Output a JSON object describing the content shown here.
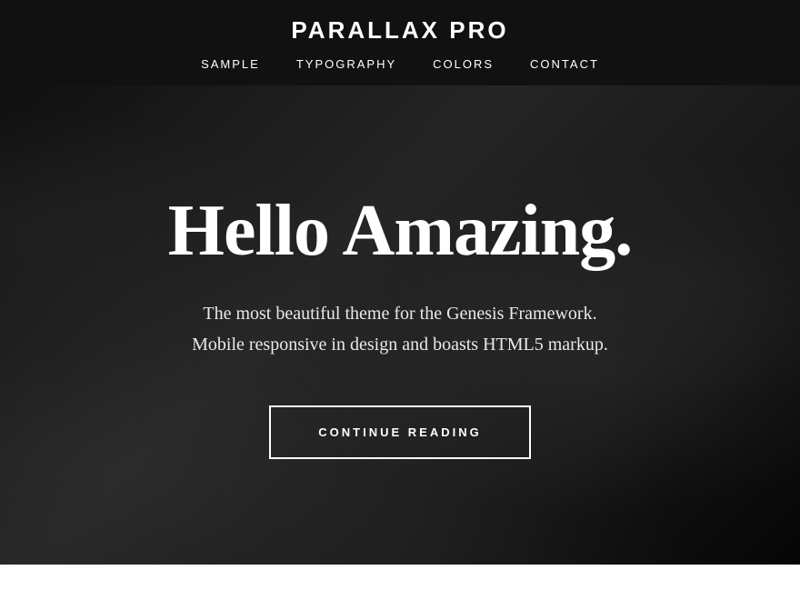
{
  "header": {
    "site_title": "PARALLAX PRO",
    "nav": {
      "items": [
        {
          "label": "SAMPLE",
          "id": "sample"
        },
        {
          "label": "TYPOGRAPHY",
          "id": "typography"
        },
        {
          "label": "COLORS",
          "id": "colors"
        },
        {
          "label": "CONTACT",
          "id": "contact"
        }
      ]
    }
  },
  "hero": {
    "heading": "Hello Amazing.",
    "subtext_line1": "The most beautiful theme for the Genesis Framework.",
    "subtext_line2": "Mobile responsive in design and boasts HTML5 markup.",
    "cta_label": "CONTINUE READING"
  },
  "colors": {
    "header_bg": "#111111",
    "hero_overlay": "rgba(0,0,0,0.35)",
    "text_white": "#ffffff",
    "button_border": "#ffffff"
  }
}
